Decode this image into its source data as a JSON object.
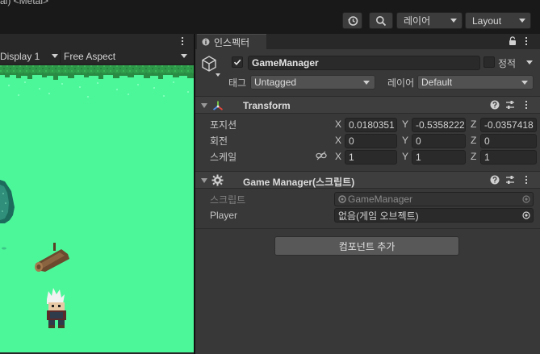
{
  "window": {
    "title_fragment": "al) <Metal>"
  },
  "toolbar": {
    "history_icon": "history-icon",
    "search_icon": "search-icon",
    "layer_dropdown": "레이어",
    "layout_dropdown": "Layout"
  },
  "game_view": {
    "display": "Display 1",
    "aspect": "Free Aspect",
    "ground_color": "#4cf79a"
  },
  "inspector": {
    "tab_label": "인스펙터",
    "object_name": "GameManager",
    "active": true,
    "static_label": "정적",
    "tag_label": "태그",
    "tag_value": "Untagged",
    "layer_label": "레이어",
    "layer_value": "Default",
    "transform": {
      "title": "Transform",
      "position_label": "포지션",
      "rotation_label": "회전",
      "scale_label": "스케일",
      "position": {
        "x": "0.0180351",
        "y": "-0.5358222",
        "z": "-0.0357418"
      },
      "rotation": {
        "x": "0",
        "y": "0",
        "z": "0"
      },
      "scale": {
        "x": "1",
        "y": "1",
        "z": "1"
      },
      "axis_x": "X",
      "axis_y": "Y",
      "axis_z": "Z"
    },
    "game_manager": {
      "title": "Game Manager(",
      "title_suffix": "스크립트",
      "title_close": ")",
      "script_label": "스크립트",
      "script_value": "GameManager",
      "player_label": "Player",
      "player_value": "없음(게임 오브젝트)"
    },
    "add_component": "컴포넌트 추가"
  }
}
